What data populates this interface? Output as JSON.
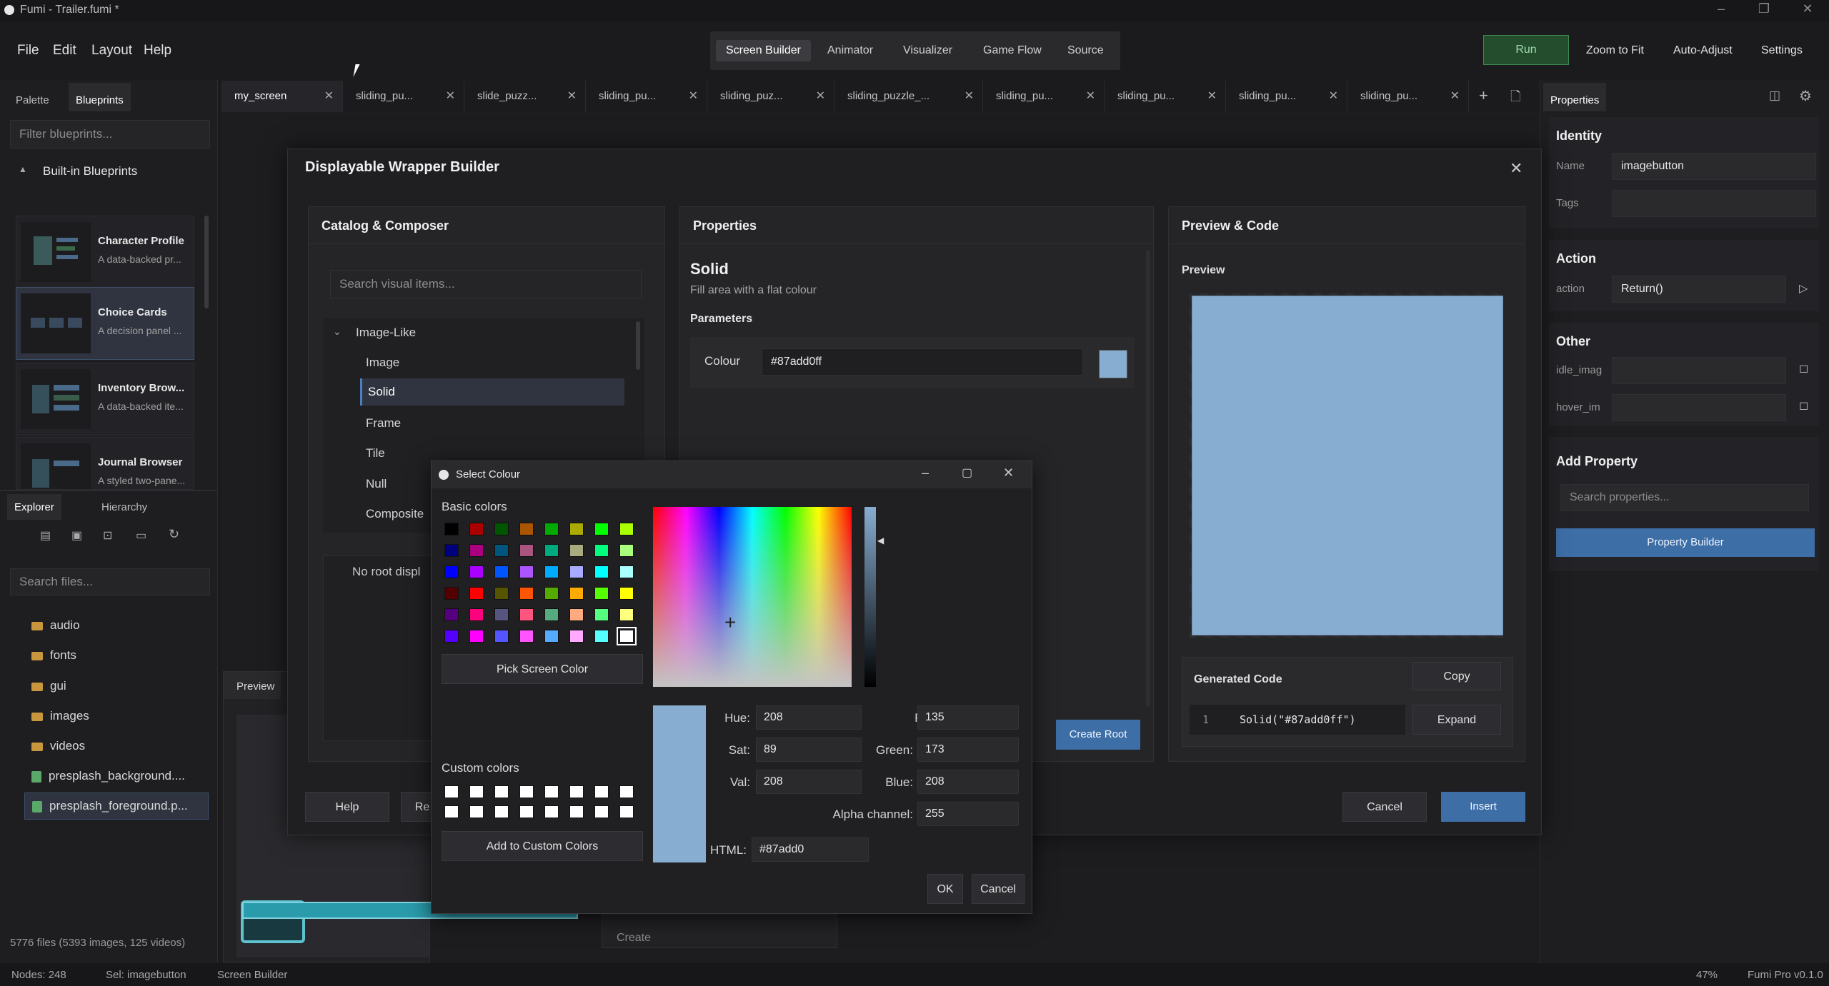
{
  "window": {
    "title": "Fumi - Trailer.fumi *"
  },
  "menu": [
    "File",
    "Edit",
    "Layout",
    "Help"
  ],
  "modes": [
    "Screen Builder",
    "Animator",
    "Visualizer",
    "Game Flow",
    "Source"
  ],
  "toolbar": {
    "run": "Run",
    "zoom_fit": "Zoom to Fit",
    "auto_adjust": "Auto-Adjust",
    "settings": "Settings"
  },
  "left": {
    "tabs": [
      "Palette",
      "Blueprints"
    ],
    "filter_placeholder": "Filter blueprints...",
    "section": "Built-in Blueprints",
    "blueprints": [
      {
        "name": "Character Profile",
        "desc": "A data-backed pr..."
      },
      {
        "name": "Choice Cards",
        "desc": "A decision panel ..."
      },
      {
        "name": "Inventory Brow...",
        "desc": "A data-backed ite..."
      },
      {
        "name": "Journal Browser",
        "desc": "A styled two-pane..."
      }
    ],
    "explorer_tabs": [
      "Explorer",
      "Hierarchy"
    ],
    "search_files_placeholder": "Search files...",
    "files": [
      "audio",
      "fonts",
      "gui",
      "images",
      "videos",
      "presplash_background....",
      "presplash_foreground.p..."
    ],
    "file_count": "5776 files (5393 images, 125 videos)"
  },
  "doc_tabs": [
    "my_screen",
    "sliding_pu...",
    "slide_puzz...",
    "sliding_pu...",
    "sliding_puz...",
    "sliding_puzzle_...",
    "sliding_pu...",
    "sliding_pu...",
    "sliding_pu...",
    "sliding_pu..."
  ],
  "canvas": {
    "preview_label": "Preview",
    "create_label": "Create"
  },
  "right": {
    "tab": "Properties",
    "identity": {
      "title": "Identity",
      "name_label": "Name",
      "name_value": "imagebutton",
      "tags_label": "Tags"
    },
    "action": {
      "title": "Action",
      "label": "action",
      "value": "Return()"
    },
    "other": {
      "title": "Other",
      "idle": "idle_imag",
      "hover": "hover_im"
    },
    "add": {
      "title": "Add Property",
      "placeholder": "Search properties...",
      "builder": "Property Builder"
    }
  },
  "dialog": {
    "title": "Displayable Wrapper Builder",
    "catalog": {
      "title": "Catalog & Composer",
      "search": "Search visual items...",
      "group": "Image-Like",
      "items": [
        "Image",
        "Solid",
        "Frame",
        "Tile",
        "Null",
        "Composite"
      ],
      "empty": "No root displ"
    },
    "props": {
      "title": "Properties",
      "heading": "Solid",
      "subtitle": "Fill area with a flat colour",
      "params": "Parameters",
      "colour_label": "Colour",
      "colour_value": "#87add0ff",
      "create_root": "Create Root"
    },
    "preview": {
      "title": "Preview & Code",
      "preview": "Preview",
      "gen_code": "Generated Code",
      "copy": "Copy",
      "line": "1",
      "code": "Solid(\"#87add0ff\")",
      "expand": "Expand"
    },
    "footer": {
      "help": "Help",
      "reset": "Re",
      "cancel": "Cancel",
      "insert": "Insert"
    },
    "preview_color": "#87add0"
  },
  "color_dialog": {
    "title": "Select Colour",
    "basic": "Basic colors",
    "pick": "Pick Screen Color",
    "custom": "Custom colors",
    "add_custom": "Add to Custom Colors",
    "hue_label": "Hue:",
    "hue": "208",
    "sat_label": "Sat:",
    "sat": "89",
    "val_label": "Val:",
    "val": "208",
    "red_label": "Red:",
    "red": "135",
    "green_label": "Green:",
    "green": "173",
    "blue_label": "Blue:",
    "blue": "208",
    "alpha_label": "Alpha channel:",
    "alpha": "255",
    "html_label": "HTML:",
    "html": "#87add0",
    "ok": "OK",
    "cancel": "Cancel",
    "swatches": [
      "#000000",
      "#aa0000",
      "#005500",
      "#aa5500",
      "#00aa00",
      "#aaaa00",
      "#00ff00",
      "#aaff00",
      "#00007f",
      "#aa007f",
      "#00557f",
      "#aa557f",
      "#00aa7f",
      "#aaaa7f",
      "#00ff7f",
      "#aaff7f",
      "#0000ff",
      "#aa00ff",
      "#0055ff",
      "#aa55ff",
      "#00aaff",
      "#aaaaff",
      "#00ffff",
      "#aaffff",
      "#550000",
      "#ff0000",
      "#555500",
      "#ff5500",
      "#55aa00",
      "#ffaa00",
      "#55ff00",
      "#ffff00",
      "#55007f",
      "#ff007f",
      "#55557f",
      "#ff557f",
      "#55aa7f",
      "#ffaa7f",
      "#55ff7f",
      "#ffff7f",
      "#5500ff",
      "#ff00ff",
      "#5555ff",
      "#ff55ff",
      "#55aaff",
      "#ffaaff",
      "#55ffff",
      "#ffffff"
    ]
  },
  "status": {
    "nodes": "Nodes: 248",
    "sel": "Sel: imagebutton",
    "mode": "Screen Builder",
    "zoom": "47%",
    "version": "Fumi Pro v0.1.0"
  }
}
